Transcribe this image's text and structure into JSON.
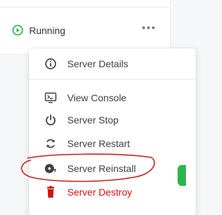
{
  "server": {
    "status": "Running"
  },
  "menu": {
    "items": [
      {
        "label": "Server Details",
        "icon": "info-circle-icon"
      },
      {
        "label": "View Console",
        "icon": "console-icon"
      },
      {
        "label": "Server Stop",
        "icon": "power-icon"
      },
      {
        "label": "Server Restart",
        "icon": "restart-icon"
      },
      {
        "label": "Server Reinstall",
        "icon": "disc-reinstall-icon"
      },
      {
        "label": "Server Destroy",
        "icon": "trash-icon"
      }
    ]
  },
  "colors": {
    "running_green": "#2fb44a",
    "danger_red": "#d51010",
    "annotation_red": "#cc1a1a"
  }
}
